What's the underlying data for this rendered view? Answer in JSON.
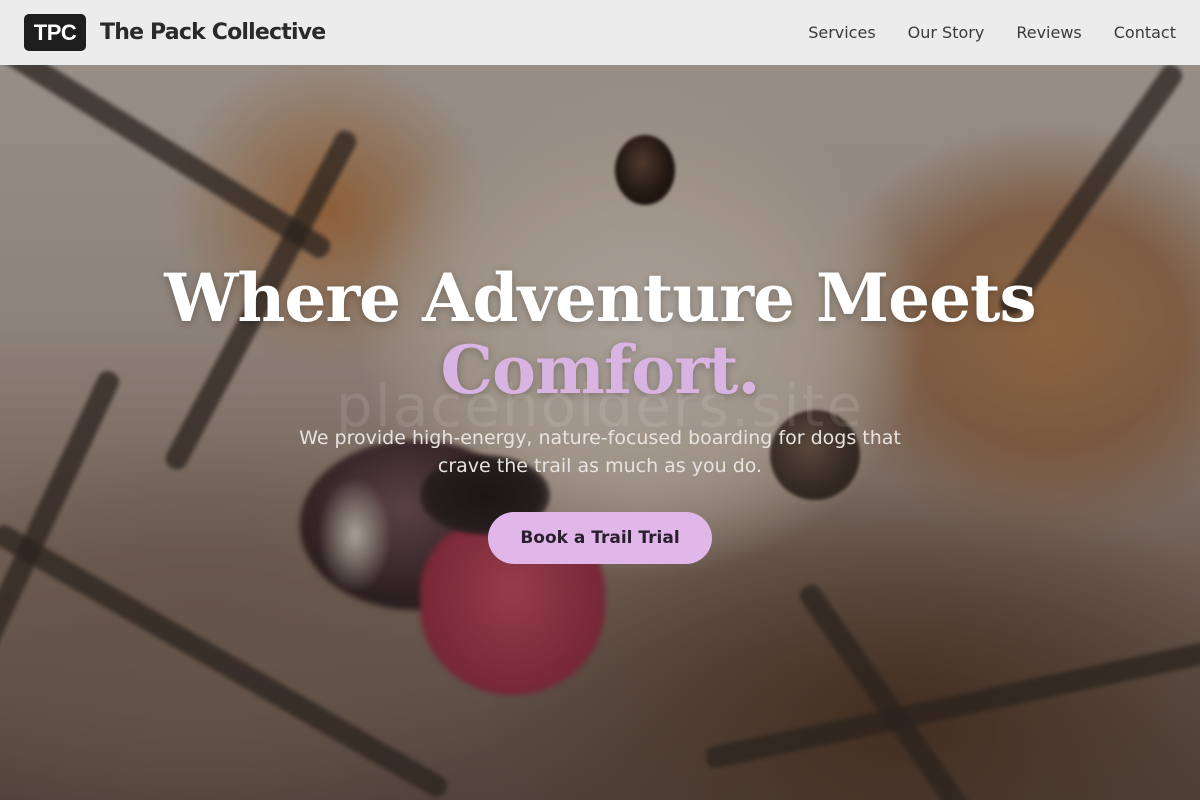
{
  "header": {
    "logo_text": "TPC",
    "brand_name": "The Pack Collective",
    "nav": [
      {
        "label": "Services"
      },
      {
        "label": "Our Story"
      },
      {
        "label": "Reviews"
      },
      {
        "label": "Contact"
      }
    ]
  },
  "hero": {
    "headline_line1": "Where Adventure Meets",
    "headline_accent": "Comfort.",
    "subtitle": "We provide high-energy, nature-focused boarding for dogs that crave the trail as much as you do.",
    "cta_label": "Book a Trail Trial",
    "watermark": "placeholders.site"
  },
  "colors": {
    "accent": "#d9b4e3",
    "button": "#e0b7e8",
    "header_bg": "#ececec",
    "logo_bg": "#1e1e1e"
  }
}
